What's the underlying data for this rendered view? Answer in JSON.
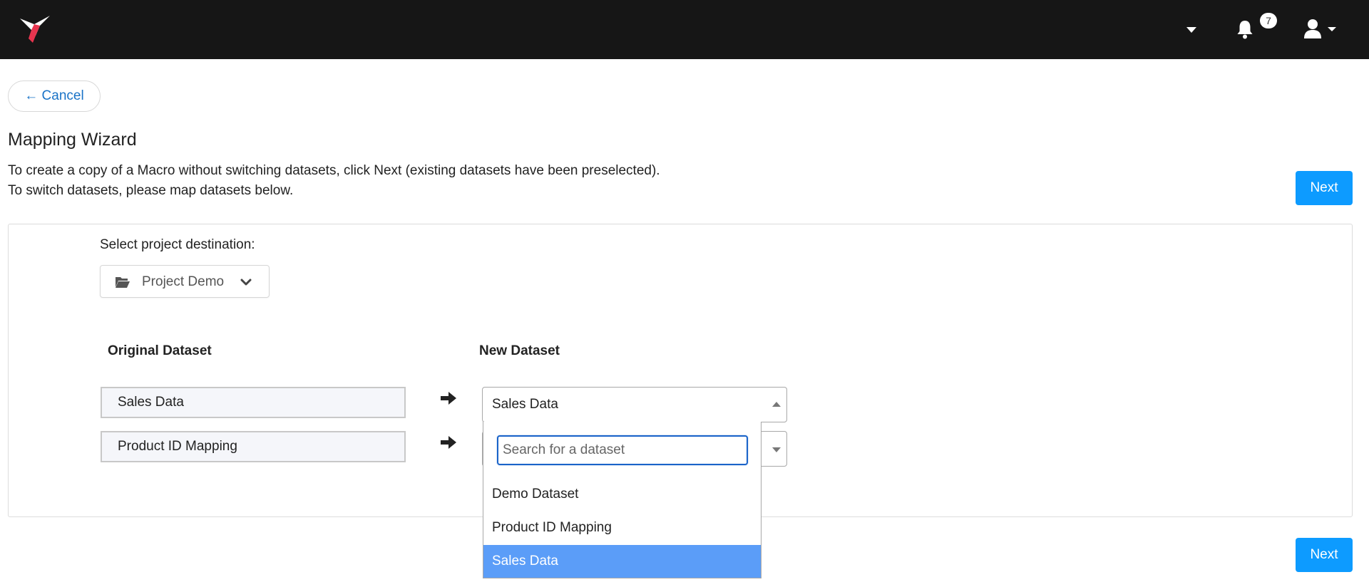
{
  "header": {
    "notification_count": "7",
    "icons": [
      "hummingbird-logo-icon",
      "caret-down-icon",
      "bell-icon",
      "user-icon"
    ]
  },
  "nav": {
    "cancel_label": "← Cancel"
  },
  "page": {
    "title": "Mapping Wizard",
    "description_line1": "To create a copy of a Macro without switching datasets, click Next (existing datasets have been preselected).",
    "description_line2": "To switch datasets, please map datasets below.",
    "next_label": "Next"
  },
  "destination": {
    "label": "Select project destination:",
    "project": "Project Demo"
  },
  "mapping": {
    "original_header": "Original Dataset",
    "new_header": "New Dataset",
    "rows": [
      {
        "original": "Sales Data",
        "new": "Sales Data"
      },
      {
        "original": "Product ID Mapping",
        "new": ""
      }
    ]
  },
  "dropdown": {
    "search_placeholder": "Search for a dataset",
    "options": [
      "Demo Dataset",
      "Product ID Mapping",
      "Sales Data"
    ],
    "selected": "Sales Data"
  },
  "colors": {
    "topbar": "#161616",
    "logo_accent": "#e8344e",
    "primary_button": "#0d9bff",
    "link": "#1a73c7",
    "selected_option": "#5b9df8"
  }
}
